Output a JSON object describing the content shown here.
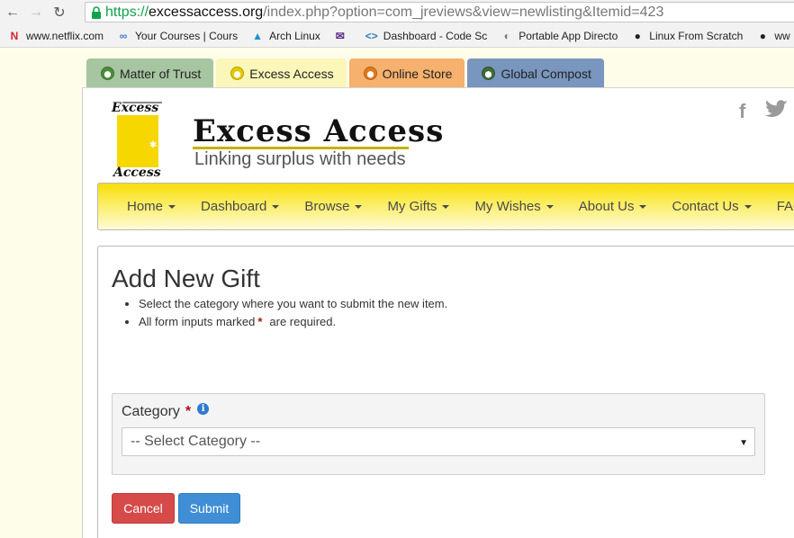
{
  "browser": {
    "url_scheme": "https://",
    "url_domain": "excessaccess.org",
    "url_rest": "/index.php?option=com_jreviews&view=newlisting&Itemid=423"
  },
  "bookmarks": [
    {
      "label": "www.netflix.com",
      "icon": "netflix-icon",
      "color": "#d81f26",
      "glyph": "N"
    },
    {
      "label": "Your Courses | Cours",
      "icon": "link-icon",
      "color": "#3b78d6",
      "glyph": "∞"
    },
    {
      "label": "Arch Linux",
      "icon": "arch-icon",
      "color": "#1793d1",
      "glyph": "▲"
    },
    {
      "label": "",
      "icon": "mail-icon",
      "color": "#5b2a86",
      "glyph": "✉"
    },
    {
      "label": "Dashboard - Code Sc",
      "icon": "code-icon",
      "color": "#2c7fb8",
      "glyph": "<>"
    },
    {
      "label": "Portable App Directo",
      "icon": "portable-icon",
      "color": "#777777",
      "glyph": "◐"
    },
    {
      "label": "Linux From Scratch",
      "icon": "tux-icon",
      "color": "#222222",
      "glyph": "●"
    },
    {
      "label": "ww",
      "icon": "tux-icon",
      "color": "#222222",
      "glyph": "●"
    }
  ],
  "site_tabs": [
    {
      "label": "Matter of Trust",
      "bg": "#a7c5a0",
      "icon_color": "#4a8c3c"
    },
    {
      "label": "Excess Access",
      "bg": "#fbf6b9",
      "icon_color": "#e6c800"
    },
    {
      "label": "Online Store",
      "bg": "#f5b16d",
      "icon_color": "#e07a1f"
    },
    {
      "label": "Global Compost",
      "bg": "#7896be",
      "icon_color": "#3f6a3a"
    }
  ],
  "brand": {
    "logo_top": "Excess",
    "logo_bottom": "Access",
    "title": "Excess Access",
    "tagline": "Linking surplus with needs"
  },
  "social": {
    "facebook": "f",
    "twitter": "🐦"
  },
  "menu": [
    {
      "label": "Home"
    },
    {
      "label": "Dashboard"
    },
    {
      "label": "Browse"
    },
    {
      "label": "My Gifts"
    },
    {
      "label": "My Wishes"
    },
    {
      "label": "About Us"
    },
    {
      "label": "Contact Us"
    },
    {
      "label": "FAQ"
    }
  ],
  "form": {
    "title": "Add New Gift",
    "note_1": "Select the category where you want to submit the new item.",
    "note_2_before": "All form inputs marked",
    "note_2_star": "*",
    "note_2_after": "are required.",
    "category_label": "Category",
    "required_star": "*",
    "info_glyph": "i",
    "select_value": "-- Select Category --",
    "cancel_label": "Cancel",
    "submit_label": "Submit"
  }
}
